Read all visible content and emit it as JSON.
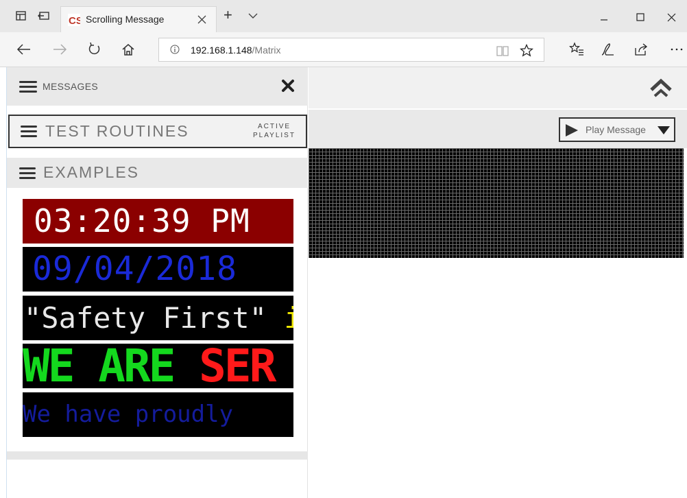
{
  "browser": {
    "tab_title": "Scrolling Message",
    "new_tab": "+",
    "address": {
      "host": "192.168.1.148",
      "path": "/Matrix"
    }
  },
  "sidebar": {
    "header_title": "MESSAGES",
    "playlist": {
      "title": "TEST ROUTINES",
      "tag_line1": "ACTIVE",
      "tag_line2": "PLAYLIST"
    },
    "category": {
      "title": "EXAMPLES"
    },
    "examples": {
      "time": "03:20:39 PM",
      "date": "09/04/2018",
      "safety_text": "\"Safety First\"",
      "safety_highlight": "i",
      "serve_green": "WE ARE",
      "serve_red": "SER",
      "proud_text": "We have proudly"
    }
  },
  "main": {
    "play_select": {
      "label": "Play Message"
    }
  },
  "colors": {
    "time_bg": "#8b0000",
    "date_text": "#1a2ad8",
    "serve_green": "#14d81e",
    "serve_red": "#ff1a1a",
    "highlight_yellow": "#f2ea00",
    "proud_text": "#141c9c"
  },
  "icons": {
    "tab_actions": [
      "tab-set-aside-icon",
      "restore-tabs-icon"
    ],
    "favicon": "cs-favicon-icon",
    "nav": [
      "back-arrow-icon",
      "forward-arrow-icon",
      "refresh-icon",
      "home-icon"
    ],
    "address": [
      "info-icon",
      "reading-view-icon",
      "favorite-star-icon"
    ],
    "toolbar": [
      "favorites-hub-icon",
      "web-note-icon",
      "share-icon",
      "more-icon"
    ],
    "page": [
      "hamburger-icon",
      "close-x-icon",
      "home-chevron-icon",
      "play-triangle-icon",
      "dropdown-triangle-icon"
    ]
  }
}
